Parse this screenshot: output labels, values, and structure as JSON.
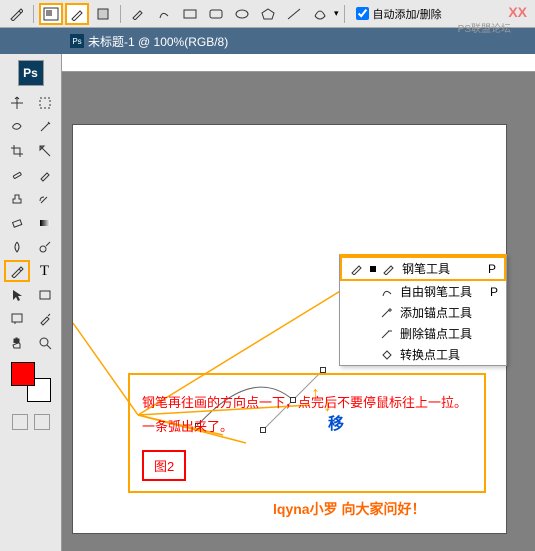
{
  "top_toolbar": {
    "checkbox_label": "自动添加/删除"
  },
  "watermark": {
    "red": "XX",
    "gray": "PS联盟论坛"
  },
  "tab": {
    "title": "未标题-1 @ 100%(RGB/8)"
  },
  "flyout": {
    "items": [
      {
        "label": "钢笔工具",
        "shortcut": "P",
        "icon": "pen"
      },
      {
        "label": "自由钢笔工具",
        "shortcut": "P",
        "icon": "freeform-pen"
      },
      {
        "label": "添加锚点工具",
        "shortcut": "",
        "icon": "pen-plus"
      },
      {
        "label": "删除锚点工具",
        "shortcut": "",
        "icon": "pen-minus"
      },
      {
        "label": "转换点工具",
        "shortcut": "",
        "icon": "convert"
      }
    ]
  },
  "instruction": {
    "line1": "钢笔再往画的方向点一下，点完后不要停鼠标往上一拉。",
    "line2": "一条弧出来了。",
    "fig_label": "图2"
  },
  "curve": {
    "move_char": "移"
  },
  "signature": "lqyna小罗 向大家问好！",
  "icons": {
    "pen": "pen-icon",
    "rect": "rect-icon",
    "shape": "shape-icon",
    "rounded": "rounded-rect",
    "ellipse": "ellipse",
    "polygon": "polygon",
    "line": "line",
    "custom": "custom-shape"
  }
}
